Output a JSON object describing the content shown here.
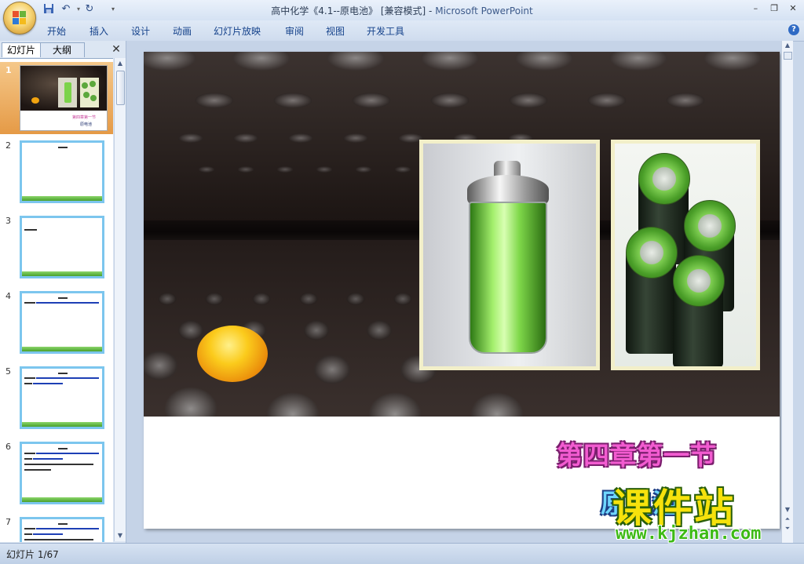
{
  "window": {
    "doc_title": "高中化学《4.1--原电池》",
    "mode": "[兼容模式]",
    "separator": "-",
    "app_name": "Microsoft PowerPoint"
  },
  "quick_access": {
    "icons": [
      "save-icon",
      "undo-icon",
      "redo-icon",
      "customize-icon"
    ]
  },
  "ribbon": {
    "tabs": [
      "开始",
      "插入",
      "设计",
      "动画",
      "幻灯片放映",
      "审阅",
      "视图",
      "开发工具"
    ]
  },
  "panel": {
    "tab_slides": "幻灯片",
    "tab_outline": "大纲",
    "close_label": "✕"
  },
  "slides": [
    {
      "num": "1"
    },
    {
      "num": "2"
    },
    {
      "num": "3"
    },
    {
      "num": "4"
    },
    {
      "num": "5"
    },
    {
      "num": "6"
    },
    {
      "num": "7"
    }
  ],
  "slide_content": {
    "subtitle": "第四章第一节",
    "title": "原电池"
  },
  "status": {
    "slide_indicator": "幻灯片 1/67"
  },
  "watermark": {
    "brand": "课件站",
    "url": "www.kjzhan.com"
  },
  "colors": {
    "accent": "#15428b",
    "selected_thumb": "#e59a46",
    "thumb_border": "#7cc6ee"
  }
}
